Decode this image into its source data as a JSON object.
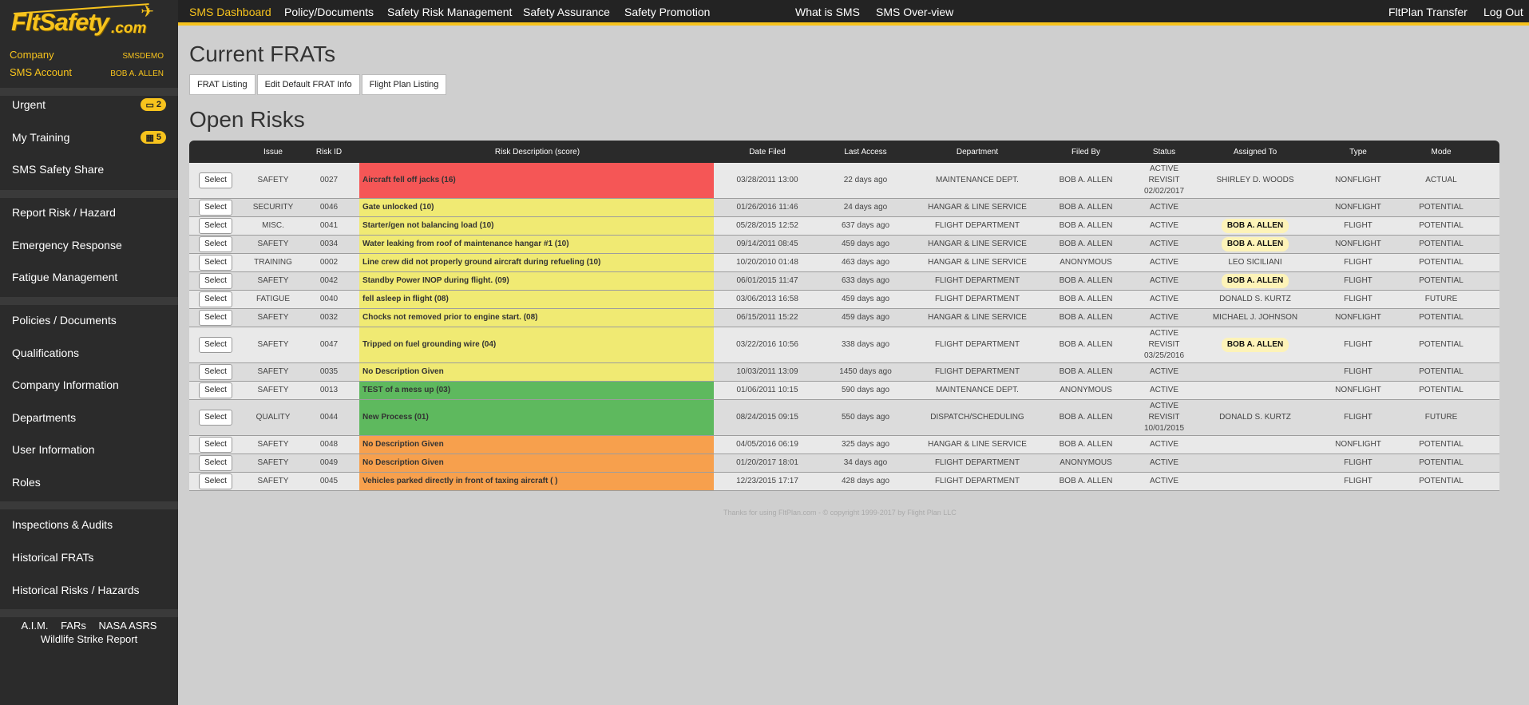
{
  "logo": {
    "name": "FltSafety",
    "suffix": ".com"
  },
  "account": {
    "company_label": "Company",
    "company_value": "SMSDEMO",
    "sms_label": "SMS Account",
    "sms_value": "BOB A. ALLEN"
  },
  "sidebar": {
    "group1": [
      {
        "label": "Urgent",
        "badge": "2",
        "badge_icon": "inbox-icon"
      },
      {
        "label": "My Training",
        "badge": "5",
        "badge_icon": "calendar-icon"
      },
      {
        "label": "SMS Safety Share"
      }
    ],
    "group2": [
      {
        "label": "Report Risk / Hazard"
      },
      {
        "label": "Emergency Response"
      },
      {
        "label": "Fatigue Management"
      }
    ],
    "group3": [
      {
        "label": "Policies / Documents"
      },
      {
        "label": "Qualifications"
      },
      {
        "label": "Company Information"
      },
      {
        "label": "Departments"
      },
      {
        "label": "User Information"
      },
      {
        "label": "Roles"
      }
    ],
    "group4": [
      {
        "label": "Inspections & Audits"
      },
      {
        "label": "Historical FRATs"
      },
      {
        "label": "Historical Risks / Hazards"
      }
    ],
    "links": [
      "A.I.M.",
      "FARs",
      "NASA ASRS",
      "Wildlife Strike Report"
    ]
  },
  "nav": {
    "items": [
      "SMS Dashboard",
      "Policy/Documents",
      "Safety Risk Management",
      "Safety Assurance",
      "Safety Promotion",
      "What is SMS",
      "SMS Over-view",
      "FltPlan Transfer",
      "Log Out"
    ],
    "active": "SMS Dashboard"
  },
  "main": {
    "title": "Current FRATs",
    "buttons": [
      "FRAT Listing",
      "Edit Default FRAT Info",
      "Flight Plan Listing"
    ],
    "risks_title": "Open Risks",
    "select_label": "Select"
  },
  "table": {
    "headers": [
      "",
      "Issue",
      "Risk ID",
      "Risk Description (score)",
      "Date Filed",
      "Last Access",
      "Department",
      "Filed By",
      "Status",
      "Assigned To",
      "Type",
      "Mode"
    ],
    "rows": [
      {
        "issue": "SAFETY",
        "id": "0027",
        "desc": "Aircraft fell off jacks (16)",
        "date": "03/28/2011 13:00",
        "last": "22 days ago",
        "dept": "MAINTENANCE DEPT.",
        "filed": "BOB A. ALLEN",
        "status": "ACTIVE\nREVISIT\n02/02/2017",
        "assigned": "SHIRLEY D. WOODS",
        "assigned_highlight": false,
        "type": "NONFLIGHT",
        "mode": "ACTUAL",
        "color": "#f55656",
        "tall": true
      },
      {
        "issue": "SECURITY",
        "id": "0046",
        "desc": "Gate unlocked (10)",
        "date": "01/26/2016 11:46",
        "last": "24 days ago",
        "dept": "HANGAR & LINE SERVICE",
        "filed": "BOB A. ALLEN",
        "status": "ACTIVE",
        "assigned": "",
        "assigned_highlight": false,
        "type": "NONFLIGHT",
        "mode": "POTENTIAL",
        "color": "#f0ea73",
        "tall": false
      },
      {
        "issue": "MISC.",
        "id": "0041",
        "desc": "Starter/gen not balancing load (10)",
        "date": "05/28/2015 12:52",
        "last": "637 days ago",
        "dept": "FLIGHT DEPARTMENT",
        "filed": "BOB A. ALLEN",
        "status": "ACTIVE",
        "assigned": "BOB A. ALLEN",
        "assigned_highlight": true,
        "type": "FLIGHT",
        "mode": "POTENTIAL",
        "color": "#f0ea73",
        "tall": false
      },
      {
        "issue": "SAFETY",
        "id": "0034",
        "desc": "Water leaking from roof of maintenance hangar #1 (10)",
        "date": "09/14/2011 08:45",
        "last": "459 days ago",
        "dept": "HANGAR & LINE SERVICE",
        "filed": "BOB A. ALLEN",
        "status": "ACTIVE",
        "assigned": "BOB A. ALLEN",
        "assigned_highlight": true,
        "type": "NONFLIGHT",
        "mode": "POTENTIAL",
        "color": "#f0ea73",
        "tall": false
      },
      {
        "issue": "TRAINING",
        "id": "0002",
        "desc": "Line crew did not properly ground aircraft during refueling (10)",
        "date": "10/20/2010 01:48",
        "last": "463 days ago",
        "dept": "HANGAR & LINE SERVICE",
        "filed": "ANONYMOUS",
        "status": "ACTIVE",
        "assigned": "LEO SICILIANI",
        "assigned_highlight": false,
        "type": "FLIGHT",
        "mode": "POTENTIAL",
        "color": "#f0ea73",
        "tall": false
      },
      {
        "issue": "SAFETY",
        "id": "0042",
        "desc": "Standby Power INOP during flight. (09)",
        "date": "06/01/2015 11:47",
        "last": "633 days ago",
        "dept": "FLIGHT DEPARTMENT",
        "filed": "BOB A. ALLEN",
        "status": "ACTIVE",
        "assigned": "BOB A. ALLEN",
        "assigned_highlight": true,
        "type": "FLIGHT",
        "mode": "POTENTIAL",
        "color": "#f0ea73",
        "tall": false
      },
      {
        "issue": "FATIGUE",
        "id": "0040",
        "desc": "fell asleep in flight (08)",
        "date": "03/06/2013 16:58",
        "last": "459 days ago",
        "dept": "FLIGHT DEPARTMENT",
        "filed": "BOB A. ALLEN",
        "status": "ACTIVE",
        "assigned": "DONALD S. KURTZ",
        "assigned_highlight": false,
        "type": "FLIGHT",
        "mode": "FUTURE",
        "color": "#f0ea73",
        "tall": false
      },
      {
        "issue": "SAFETY",
        "id": "0032",
        "desc": "Chocks not removed prior to engine start. (08)",
        "date": "06/15/2011 15:22",
        "last": "459 days ago",
        "dept": "HANGAR & LINE SERVICE",
        "filed": "BOB A. ALLEN",
        "status": "ACTIVE",
        "assigned": "MICHAEL J. JOHNSON",
        "assigned_highlight": false,
        "type": "NONFLIGHT",
        "mode": "POTENTIAL",
        "color": "#f0ea73",
        "tall": false
      },
      {
        "issue": "SAFETY",
        "id": "0047",
        "desc": "Tripped on fuel grounding wire (04)",
        "date": "03/22/2016 10:56",
        "last": "338 days ago",
        "dept": "FLIGHT DEPARTMENT",
        "filed": "BOB A. ALLEN",
        "status": "ACTIVE\nREVISIT\n03/25/2016",
        "assigned": "BOB A. ALLEN",
        "assigned_highlight": true,
        "type": "FLIGHT",
        "mode": "POTENTIAL",
        "color": "#f0ea73",
        "tall": true
      },
      {
        "issue": "SAFETY",
        "id": "0035",
        "desc": "No Description Given",
        "date": "10/03/2011 13:09",
        "last": "1450 days ago",
        "dept": "FLIGHT DEPARTMENT",
        "filed": "BOB A. ALLEN",
        "status": "ACTIVE",
        "assigned": "",
        "assigned_highlight": false,
        "type": "FLIGHT",
        "mode": "POTENTIAL",
        "color": "#f0ea73",
        "tall": false
      },
      {
        "issue": "SAFETY",
        "id": "0013",
        "desc": "TEST of a mess up (03)",
        "date": "01/06/2011 10:15",
        "last": "590 days ago",
        "dept": "MAINTENANCE DEPT.",
        "filed": "ANONYMOUS",
        "status": "ACTIVE",
        "assigned": "",
        "assigned_highlight": false,
        "type": "NONFLIGHT",
        "mode": "POTENTIAL",
        "color": "#5eb95e",
        "tall": false
      },
      {
        "issue": "QUALITY",
        "id": "0044",
        "desc": "New Process (01)",
        "date": "08/24/2015 09:15",
        "last": "550 days ago",
        "dept": "DISPATCH/SCHEDULING",
        "filed": "BOB A. ALLEN",
        "status": "ACTIVE\nREVISIT\n10/01/2015",
        "assigned": "DONALD S. KURTZ",
        "assigned_highlight": false,
        "type": "FLIGHT",
        "mode": "FUTURE",
        "color": "#5eb95e",
        "tall": true
      },
      {
        "issue": "SAFETY",
        "id": "0048",
        "desc": "No Description Given",
        "date": "04/05/2016 06:19",
        "last": "325 days ago",
        "dept": "HANGAR & LINE SERVICE",
        "filed": "BOB A. ALLEN",
        "status": "ACTIVE",
        "assigned": "",
        "assigned_highlight": false,
        "type": "NONFLIGHT",
        "mode": "POTENTIAL",
        "color": "#f7a04d",
        "tall": false
      },
      {
        "issue": "SAFETY",
        "id": "0049",
        "desc": "No Description Given",
        "date": "01/20/2017 18:01",
        "last": "34 days ago",
        "dept": "FLIGHT DEPARTMENT",
        "filed": "ANONYMOUS",
        "status": "ACTIVE",
        "assigned": "",
        "assigned_highlight": false,
        "type": "FLIGHT",
        "mode": "POTENTIAL",
        "color": "#f7a04d",
        "tall": false
      },
      {
        "issue": "SAFETY",
        "id": "0045",
        "desc": "Vehicles parked directly in front of taxing aircraft ( )",
        "date": "12/23/2015 17:17",
        "last": "428 days ago",
        "dept": "FLIGHT DEPARTMENT",
        "filed": "BOB A. ALLEN",
        "status": "ACTIVE",
        "assigned": "",
        "assigned_highlight": false,
        "type": "FLIGHT",
        "mode": "POTENTIAL",
        "color": "#f7a04d",
        "tall": false
      }
    ]
  },
  "footer": "Thanks for using FltPlan.com - © copyright 1999-2017 by Flight Plan LLC",
  "colors": {
    "accent": "#f7c31d",
    "sidebar": "#2b2b2b",
    "topbar": "#232323",
    "high": "#f55656",
    "medium": "#f0ea73",
    "low": "#5eb95e",
    "unscored": "#f7a04d"
  }
}
